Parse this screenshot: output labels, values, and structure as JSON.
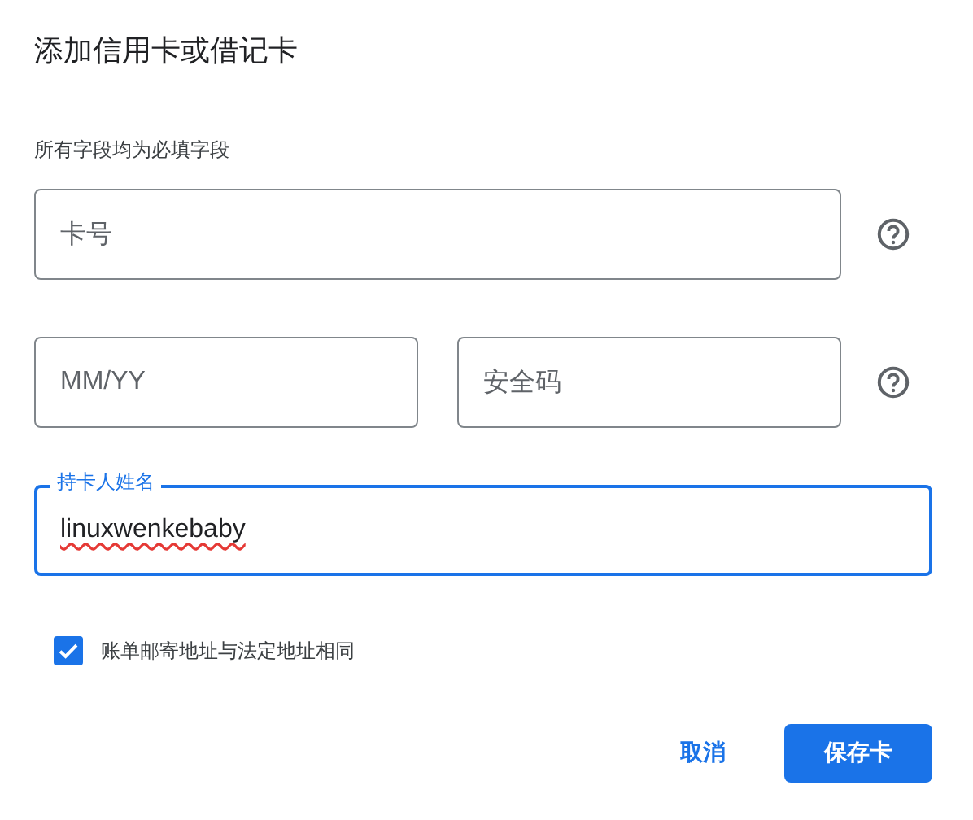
{
  "dialog": {
    "title": "添加信用卡或借记卡",
    "note": "所有字段均为必填字段",
    "rows": [
      {
        "help": true,
        "fields": [
          {
            "placeholder": "卡号"
          }
        ]
      },
      {
        "help": true,
        "fields": [
          {
            "placeholder": "MM/YY"
          },
          {
            "placeholder": "安全码"
          }
        ]
      },
      {
        "help": false,
        "fields": [
          {
            "label": "持卡人姓名",
            "value": "linuxwenkebaby",
            "focused": true,
            "misspelled": true
          }
        ]
      }
    ],
    "checkbox": {
      "label": "账单邮寄地址与法定地址相同",
      "checked": true
    },
    "buttons": [
      {
        "label": "取消",
        "kind": "text"
      },
      {
        "label": "保存卡",
        "kind": "primary"
      }
    ]
  }
}
